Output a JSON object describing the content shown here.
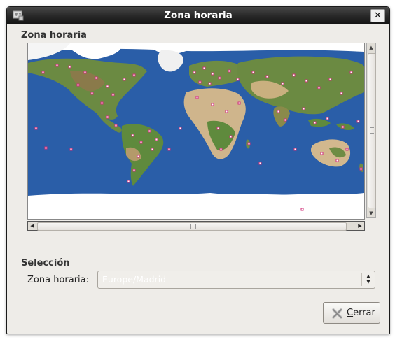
{
  "window": {
    "title": "Zona horaria",
    "close_glyph": "✕"
  },
  "map_frame": {
    "label": "Zona horaria",
    "image": "world-map-with-timezone-city-markers"
  },
  "selection": {
    "label": "Selección",
    "timezone_label": "Zona horaria:",
    "timezone_value": "Europe/Madrid"
  },
  "buttons": {
    "close_first": "C",
    "close_rest": "errar"
  },
  "icons": {
    "window": "globe-icon",
    "close": "close-icon",
    "button_close": "red-x-icon"
  },
  "colors": {
    "ocean": "#2a5ea8",
    "land_green": "#5f8a3d",
    "land_desert": "#cfb58c",
    "ice": "#ffffff",
    "titlebar": "#2a2a2a",
    "dialog_bg": "#eeece8",
    "marker": "#d0307a"
  }
}
